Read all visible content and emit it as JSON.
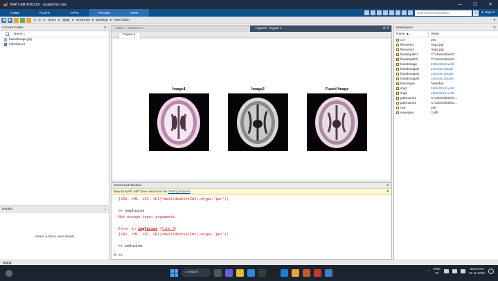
{
  "titlebar": {
    "title": "MATLAB R2022b - academic use",
    "min": "—",
    "max": "☐",
    "close": "✕"
  },
  "ribbon": {
    "tabs": [
      {
        "label": "HOME"
      },
      {
        "label": "PLOTS"
      },
      {
        "label": "APPS"
      },
      {
        "label": "FIGURE"
      },
      {
        "label": "VIEW"
      }
    ],
    "search_placeholder": "Search Documentation",
    "user": "Sign In"
  },
  "address": {
    "crumbs": [
      "C:",
      "Users",
      "shivi",
      "OneDrive",
      "Desktop",
      "New folder"
    ]
  },
  "current_folder": {
    "title": "Current Folder",
    "col_name": "Name ↓",
    "files": [
      {
        "name": "fusedImage.jpg",
        "type": "image"
      },
      {
        "name": "imfusion.m",
        "type": "m"
      }
    ]
  },
  "details": {
    "title": "Details",
    "message": "Select a file to view details"
  },
  "figure_panel": {
    "editor_tab": "Editor - imfusion.m",
    "figures_tab": "Figures - Figure 1",
    "figure_tab": "Figure 1",
    "plots": [
      {
        "title": "Image1"
      },
      {
        "title": "Image2"
      },
      {
        "title": "Fused Image"
      }
    ]
  },
  "command_window": {
    "title": "Command Window",
    "notice_text": "New to MATLAB? See resources for ",
    "notice_link": "Getting Started",
    "notice_end": ".",
    "lines": {
      "l1": "[cA1, cH1, cV1, cD1]=dwt2(double(Im1),wtype,'per');",
      "l2": ">> imgfusion",
      "l3": "Not enough input arguments.",
      "l4a": "Error in ",
      "l4b": "imgfusion",
      "l4c": " (",
      "l4d": "line 3",
      "l4e": ")",
      "l5": "[cA1, cH1, cV1, cD1]=dwt2(double(Im1),wtype,'per');",
      "l6": ">> imfusion"
    },
    "fx": "fx",
    "prompt": ">>"
  },
  "workspace": {
    "title": "Workspace",
    "col_name": "Name ▲",
    "col_value": "Value",
    "vars": [
      {
        "name": "col",
        "value": "200",
        "dim": false
      },
      {
        "name": "filename1",
        "value": "'img1.jpg'",
        "dim": false
      },
      {
        "name": "filename2",
        "value": "'img2.jpg'",
        "dim": false
      },
      {
        "name": "filewithpath1",
        "value": "'C:\\Users\\shivi\\O...",
        "dim": false
      },
      {
        "name": "filewithpath2",
        "value": "'C:\\Users\\shivi\\O...",
        "dim": false
      },
      {
        "name": "fusedImage",
        "value": "190x200x3 uint8",
        "dim": true
      },
      {
        "name": "fusedImageB",
        "value": "190x200 double",
        "dim": true
      },
      {
        "name": "fusedImageG",
        "value": "190x200 double",
        "dim": true
      },
      {
        "name": "fusedImageR",
        "value": "190x200 double",
        "dim": true
      },
      {
        "name": "fusiontype",
        "value": "'MaxMax'",
        "dim": false
      },
      {
        "name": "img1",
        "value": "190x200x3 uint8",
        "dim": true
      },
      {
        "name": "img2",
        "value": "190x200x3 uint8",
        "dim": true
      },
      {
        "name": "pathname1",
        "value": "'C:\\Users\\shivi\\O...",
        "dim": false
      },
      {
        "name": "pathname2",
        "value": "'C:\\Users\\shivi\\O...",
        "dim": false
      },
      {
        "name": "row",
        "value": "190",
        "dim": false
      },
      {
        "name": "wavetype",
        "value": "'coif5'",
        "dim": false
      }
    ]
  },
  "taskbar": {
    "search": "Search",
    "lang_top": "ENG",
    "lang_bottom": "IN",
    "time": "03:24 PM",
    "date": "21-11-2022"
  },
  "colors": {
    "titlebar": "#1e2d44",
    "ribbon": "#0e4f8a",
    "ribbon_active": "#2b6fb3",
    "error_text": "#d22222",
    "link": "#0b4fb3"
  }
}
